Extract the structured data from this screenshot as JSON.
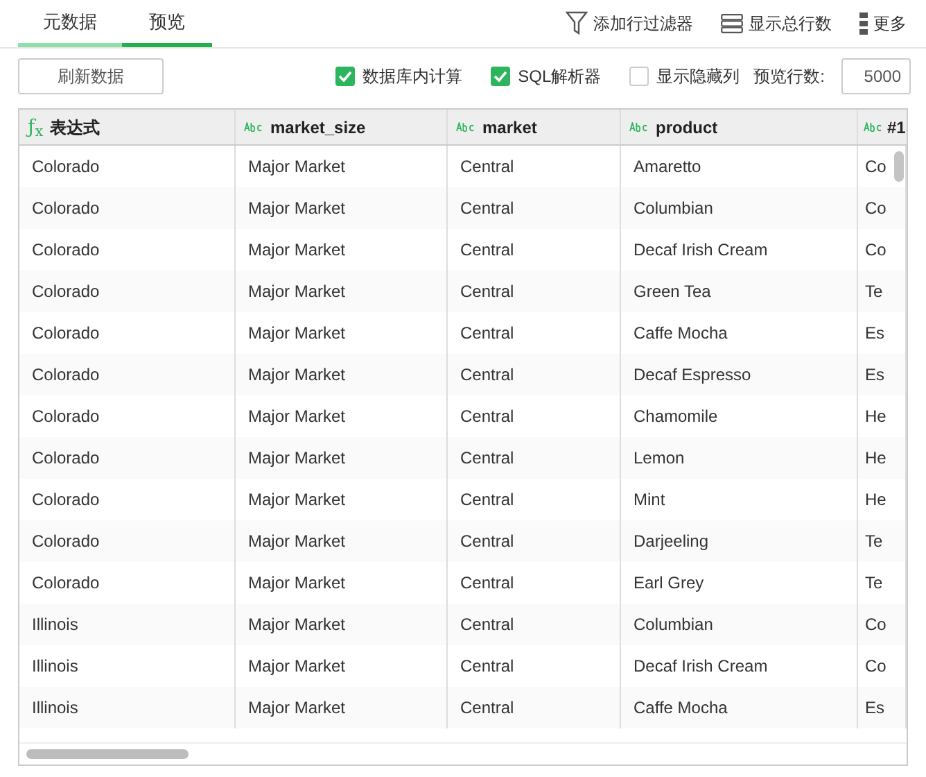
{
  "tabs": [
    {
      "label": "元数据",
      "selected": false,
      "hovered": true
    },
    {
      "label": "预览",
      "selected": true,
      "hovered": false
    }
  ],
  "toolbar": [
    {
      "label": "添加行过滤器",
      "kind": "filter"
    },
    {
      "label": "显示总行数",
      "kind": "rows"
    },
    {
      "label": "更多",
      "kind": "more"
    }
  ],
  "refresh_button": "刷新数据",
  "options": [
    {
      "label": "数据库内计算",
      "checked": true
    },
    {
      "label": "SQL解析器",
      "checked": true
    },
    {
      "label": "显示隐藏列",
      "checked": false
    }
  ],
  "preview_rows": {
    "label": "预览行数:",
    "value": "5000"
  },
  "table": {
    "columns": [
      {
        "label": "表达式",
        "kind": "formula",
        "icon": "ƒ$_{x}$"
      },
      {
        "label": "market_size",
        "kind": "text"
      },
      {
        "label": "market",
        "kind": "text"
      },
      {
        "label": "product",
        "kind": "text"
      },
      {
        "label": "#1",
        "kind": "text"
      }
    ],
    "rows": [
      [
        "Colorado",
        "Major Market",
        "Central",
        "Amaretto",
        "Co"
      ],
      [
        "Colorado",
        "Major Market",
        "Central",
        "Columbian",
        "Co"
      ],
      [
        "Colorado",
        "Major Market",
        "Central",
        "Decaf Irish Cream",
        "Co"
      ],
      [
        "Colorado",
        "Major Market",
        "Central",
        "Green Tea",
        "Te"
      ],
      [
        "Colorado",
        "Major Market",
        "Central",
        "Caffe Mocha",
        "Es"
      ],
      [
        "Colorado",
        "Major Market",
        "Central",
        "Decaf Espresso",
        "Es"
      ],
      [
        "Colorado",
        "Major Market",
        "Central",
        "Chamomile",
        "He"
      ],
      [
        "Colorado",
        "Major Market",
        "Central",
        "Lemon",
        "He"
      ],
      [
        "Colorado",
        "Major Market",
        "Central",
        "Mint",
        "He"
      ],
      [
        "Colorado",
        "Major Market",
        "Central",
        "Darjeeling",
        "Te"
      ],
      [
        "Colorado",
        "Major Market",
        "Central",
        "Earl Grey",
        "Te"
      ],
      [
        "Illinois",
        "Major Market",
        "Central",
        "Columbian",
        "Co"
      ],
      [
        "Illinois",
        "Major Market",
        "Central",
        "Decaf Irish Cream",
        "Co"
      ],
      [
        "Illinois",
        "Major Market",
        "Central",
        "Caffe Mocha",
        "Es"
      ]
    ]
  }
}
